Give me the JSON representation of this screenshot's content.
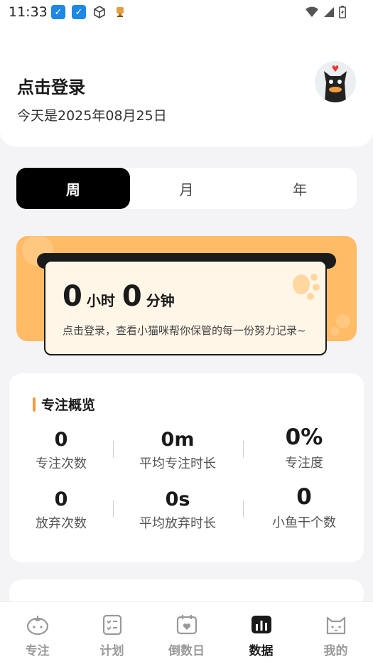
{
  "status_bar": {
    "time": "11:33"
  },
  "header": {
    "login": "点击登录",
    "date": "今天是2025年08月25日"
  },
  "tabs": [
    "周",
    "月",
    "年"
  ],
  "focus_card": {
    "hours": "0",
    "hours_unit": "小时",
    "minutes": "0",
    "minutes_unit": "分钟",
    "hint": "点击登录，查看小猫咪帮你保管的每一份努力记录~"
  },
  "overview": {
    "title": "专注概览",
    "stats": [
      {
        "value": "0",
        "label": "专注次数"
      },
      {
        "value": "0m",
        "label": "平均专注时长"
      },
      {
        "value": "0%",
        "label": "专注度"
      },
      {
        "value": "0",
        "label": "放弃次数"
      },
      {
        "value": "0s",
        "label": "平均放弃时长"
      },
      {
        "value": "0",
        "label": "小鱼干个数"
      }
    ]
  },
  "nav": [
    "专注",
    "计划",
    "倒数日",
    "数据",
    "我的"
  ],
  "colors": {
    "accent": "#ffbb66",
    "title_bar": "#f39a3c",
    "active_tab": "#000000"
  }
}
